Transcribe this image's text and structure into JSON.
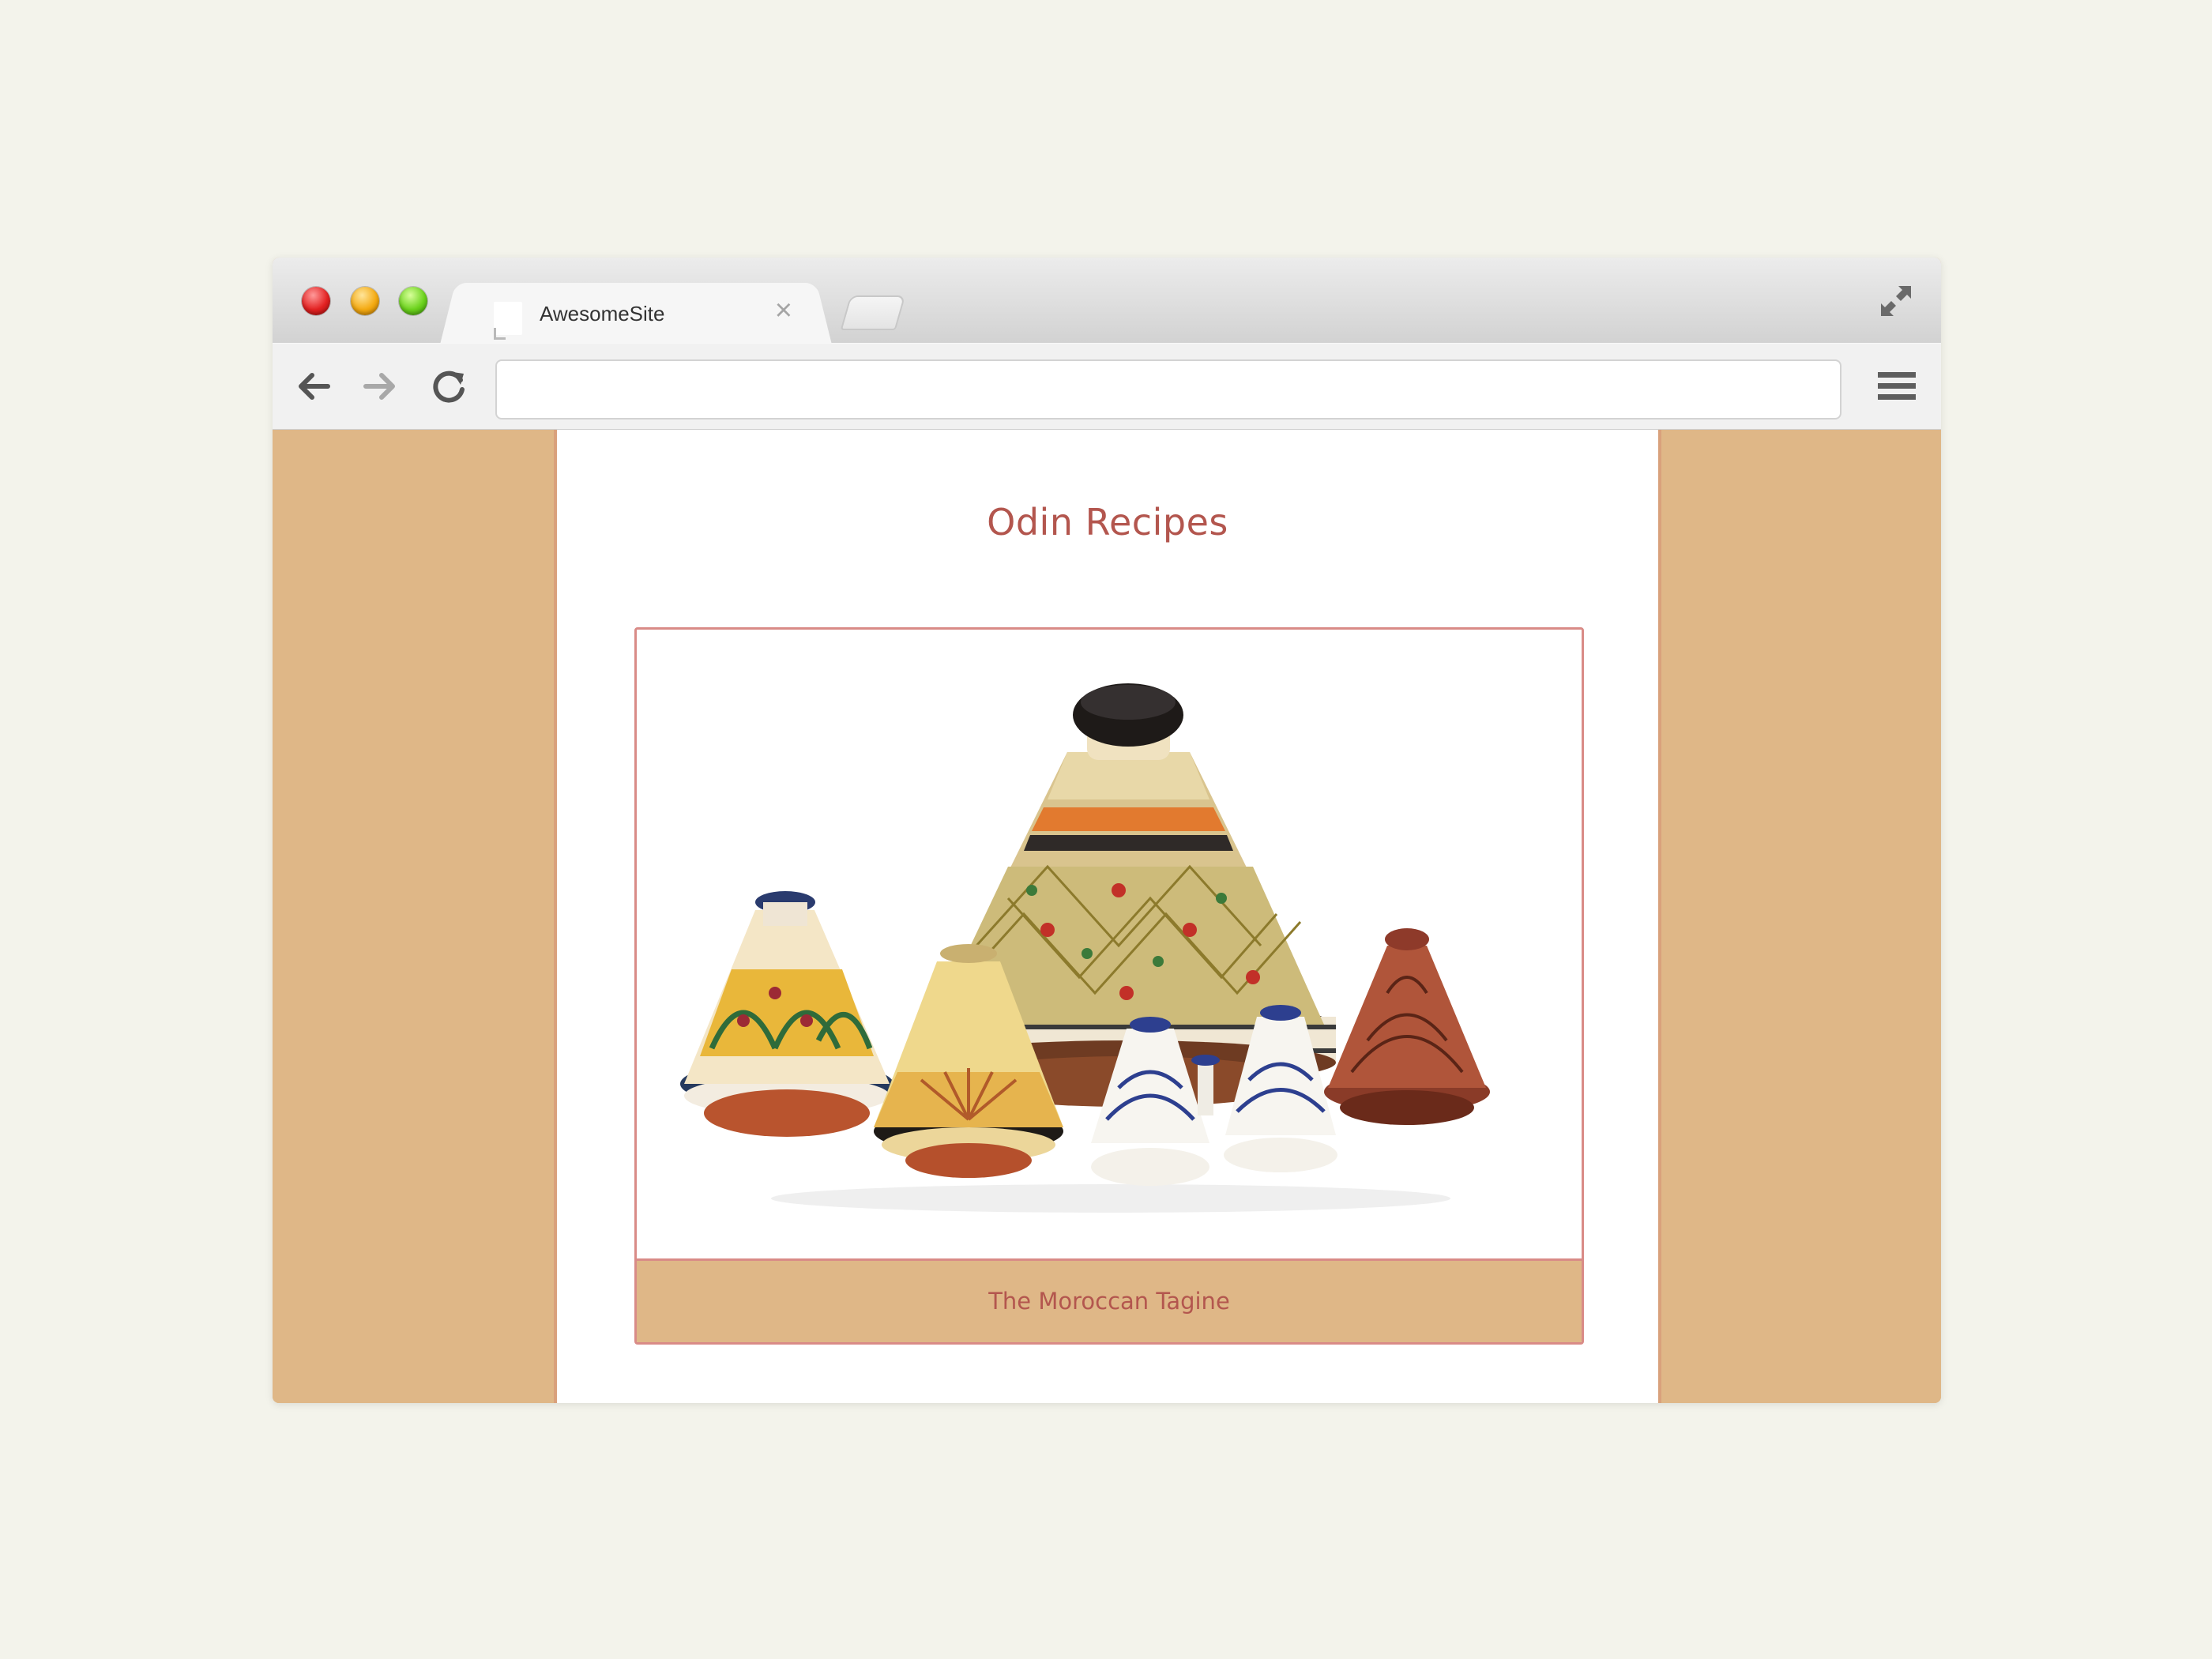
{
  "browser": {
    "tab_title": "AwesomeSite",
    "tab_close": "×",
    "address_value": "",
    "icons": [
      "close-window-light",
      "minimize-light",
      "zoom-light",
      "page-favicon",
      "close-icon",
      "new-tab",
      "fullscreen-icon",
      "back-arrow-icon",
      "forward-arrow-icon",
      "reload-icon",
      "hamburger-menu-icon"
    ]
  },
  "page": {
    "title": "Odin Recipes",
    "card": {
      "image_subject": "tagine-pots",
      "caption": "The Moroccan Tagine"
    }
  },
  "colors": {
    "page_background": "#dfb787",
    "accent_text": "#b3564e",
    "card_border": "#d98b87"
  }
}
